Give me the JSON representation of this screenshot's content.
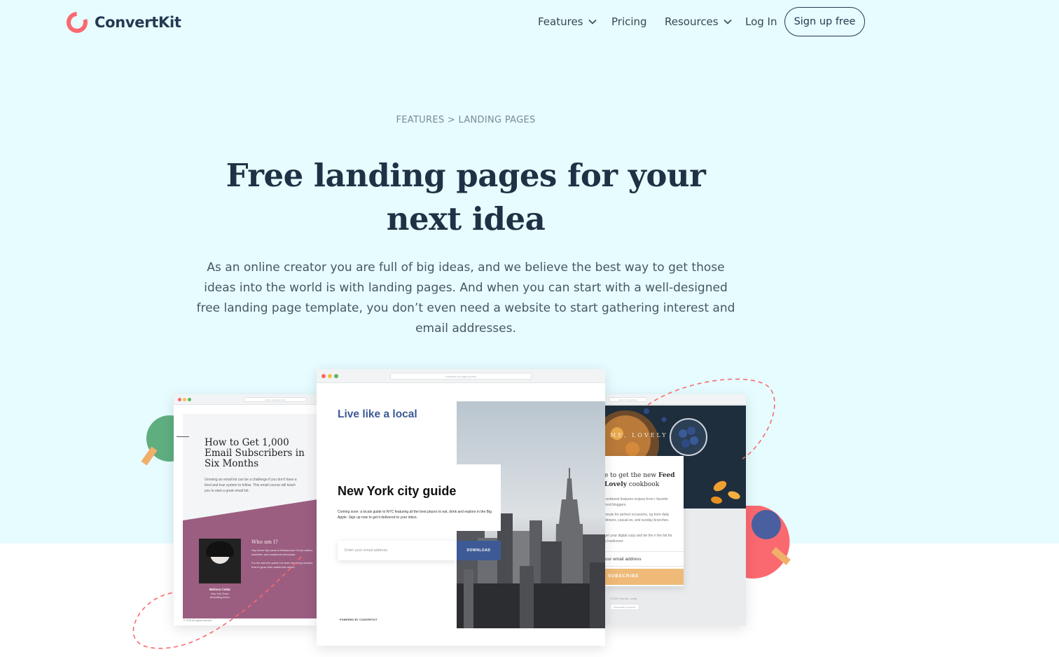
{
  "brand": {
    "name": "ConvertKit",
    "accent": "#fb6970"
  },
  "nav": {
    "features": "Features",
    "pricing": "Pricing",
    "resources": "Resources",
    "login": "Log In",
    "signup": "Sign up free"
  },
  "hero": {
    "breadcrumb_a": "FEATURES",
    "breadcrumb_sep": ">",
    "breadcrumb_b": "LANDING PAGES",
    "title": "Free landing pages for your next idea",
    "lead": "As an online creator you are full of big ideas, and we believe the best way to get those ideas into the world is with landing pages. And when you can start with a well-designed free landing page template, you don’t even need a website to start gathering interest and email addresses."
  },
  "mock_left": {
    "url": "author.ck.page/emails",
    "heading": "How to Get 1,000 Email Subscribers in Six Months",
    "body": "Growing an email list can be a challenge if you don't have a tried and true system to follow. This email course will teach you to start a great email list.",
    "who_title": "Who am I?",
    "who_body": "Hey there! My name is Melissa and I'm an author, marketer, and cookbook enthusiast.",
    "who_body2": "For the last five years I've been teaching creators how to grow their audiences online.",
    "person_name": "Melissa Cedar",
    "person_sub": "New York Times",
    "person_sub2": "Bestselling Author",
    "footer": "© 2019 All rights reserved"
  },
  "mock_center": {
    "url": "example.ck.page/nycfirst",
    "tagline": "Live like a local",
    "heading": "New York city guide",
    "body": "Coming soon: a locals guide to NYC featuring all the best places to eat, drink and explore in the Big Apple. Sign up now to get it delivered to your inbox.",
    "email_placeholder": "Enter your email address",
    "button": "DOWNLOAD",
    "powered": "POWERED BY CONVERTKIT"
  },
  "mock_right": {
    "url": "author.ck.page/feed",
    "overlay_title": "ME, LOVELY",
    "heading_a": "e to get the new ",
    "heading_b": "Feed",
    "heading_c": "Lovely",
    "heading_d": " cookbook",
    "p1": "cookbook features recipes from r favorite food bloggers.",
    "p2": "meals for perfect occasions, ng from daily dinners, casual es, and sunday brunches.",
    "p3": "get your digital copy and be the n the list for a hardcover.",
    "email_placeholder": "our email address",
    "button": "SUBSCRIBE",
    "footer": "© 2019 Feed Me, Lovely",
    "badge": "Powered By ConvertKit"
  }
}
